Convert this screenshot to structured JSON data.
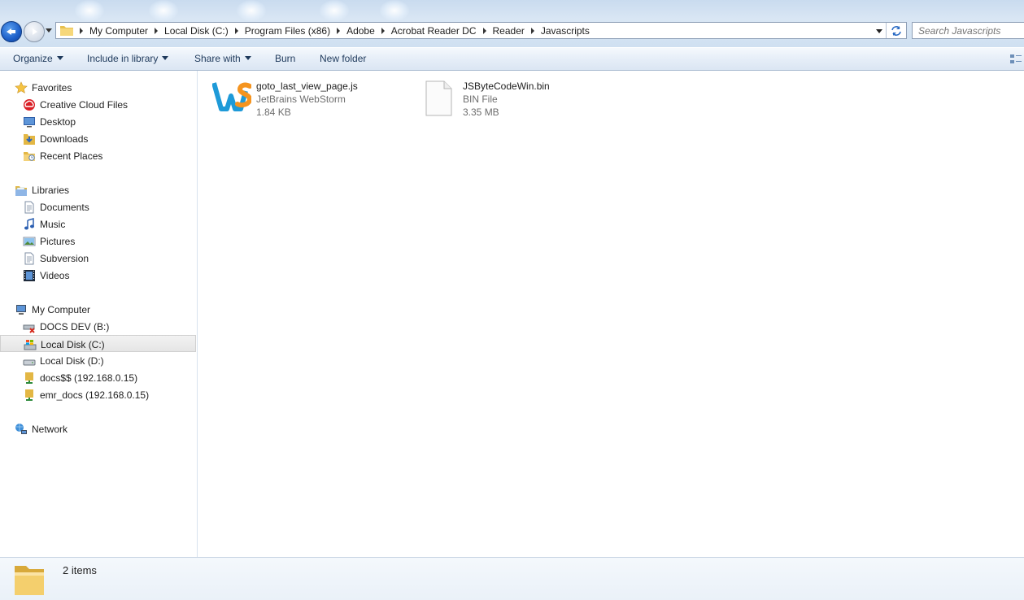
{
  "address_bar": {
    "breadcrumbs": [
      "My Computer",
      "Local Disk (C:)",
      "Program Files (x86)",
      "Adobe",
      "Acrobat Reader DC",
      "Reader",
      "Javascripts"
    ]
  },
  "search": {
    "placeholder": "Search Javascripts"
  },
  "toolbar": {
    "organize": "Organize",
    "include_in_library": "Include in library",
    "share_with": "Share with",
    "burn": "Burn",
    "new_folder": "New folder"
  },
  "navigation": {
    "favorites": {
      "label": "Favorites",
      "items": [
        "Creative Cloud Files",
        "Desktop",
        "Downloads",
        "Recent Places"
      ]
    },
    "libraries": {
      "label": "Libraries",
      "items": [
        "Documents",
        "Music",
        "Pictures",
        "Subversion",
        "Videos"
      ]
    },
    "computer": {
      "label": "My Computer",
      "items": [
        "DOCS DEV (B:)",
        "Local Disk (C:)",
        "Local Disk (D:)",
        "docs$$ (192.168.0.15)",
        "emr_docs (192.168.0.15)"
      ],
      "selected": "Local Disk (C:)"
    },
    "network": {
      "label": "Network"
    }
  },
  "files": [
    {
      "name": "goto_last_view_page.js",
      "type": "JetBrains WebStorm",
      "size": "1.84 KB",
      "icon": "webstorm-file-icon"
    },
    {
      "name": "JSByteCodeWin.bin",
      "type": "BIN File",
      "size": "3.35 MB",
      "icon": "generic-file-icon"
    }
  ],
  "status": {
    "item_count": "2 items"
  },
  "colors": {
    "titlebar": "#cfe0f1",
    "command_text": "#1e395b",
    "secondary_text": "#6d6d6d",
    "back_button": "#1d5fc8"
  }
}
